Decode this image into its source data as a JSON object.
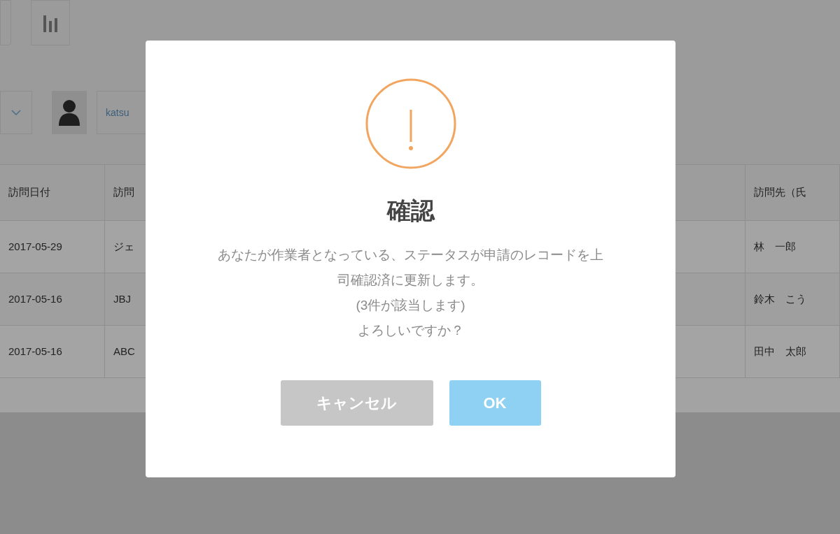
{
  "user": {
    "name": "katsu"
  },
  "table": {
    "columns": [
      {
        "label": "訪問日付"
      },
      {
        "label": "訪問"
      },
      {},
      {
        "label": "訪問先（氏"
      }
    ],
    "rows": [
      {
        "cells": [
          "2017-05-29",
          "ジェ",
          null,
          "林　一郎"
        ]
      },
      {
        "cells": [
          "2017-05-16",
          "JBJ",
          null,
          "鈴木　こう"
        ]
      },
      {
        "cells": [
          "2017-05-16",
          "ABC",
          null,
          "田中　太郎"
        ]
      }
    ]
  },
  "dialog": {
    "title": "確認",
    "message_lines": [
      "あなたが作業者となっている、ステータスが申請のレコードを上",
      "司確認済に更新します。",
      "(3件が該当します)",
      "よろしいですか？"
    ],
    "buttons": [
      {
        "label": "キャンセル",
        "kind": "cancel"
      },
      {
        "label": "OK",
        "kind": "primary"
      }
    ]
  }
}
